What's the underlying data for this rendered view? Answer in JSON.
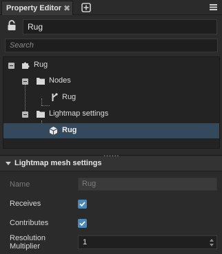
{
  "tab": {
    "title": "Property Editor",
    "close_glyph": "✖"
  },
  "icons": {
    "close": "close-icon",
    "add_tab": "plus-square-icon",
    "menu": "hamburger-menu-icon",
    "lock": "lock-icon",
    "collapse": "collapse-minus-icon",
    "puzzle": "puzzle-piece-icon",
    "folder": "folder-icon",
    "bone": "node-branch-icon",
    "cube": "cube-icon"
  },
  "name_value": "Rug",
  "search": {
    "placeholder": "Search"
  },
  "tree": {
    "items": [
      {
        "label": "Rug"
      },
      {
        "label": "Nodes"
      },
      {
        "label": "Rug"
      },
      {
        "label": "Lightmap settings"
      },
      {
        "label": "Rug"
      }
    ]
  },
  "section": {
    "title": "Lightmap mesh settings"
  },
  "properties": {
    "name_label": "Name",
    "name_value": "Rug",
    "receives_label": "Receives",
    "receives_checked": true,
    "contributes_label": "Contributes",
    "contributes_checked": true,
    "resolution_label_1": "Resolution",
    "resolution_label_2": "Multiplier",
    "resolution_value": "1"
  },
  "colors": {
    "selection": "#344a5c",
    "checkbox": "#4b87b8",
    "background": "#2b2b2b"
  }
}
